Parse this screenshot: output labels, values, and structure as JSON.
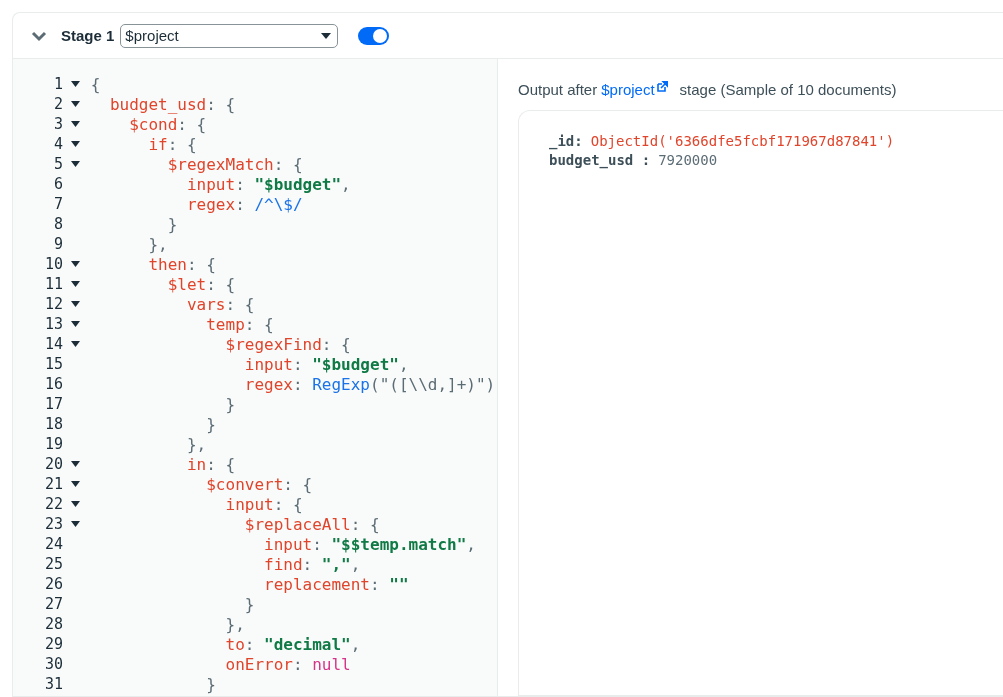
{
  "stage": {
    "expanded": true,
    "label": "Stage 1",
    "operator": "$project",
    "enabled": true
  },
  "editor": {
    "lines": [
      {
        "number": "1",
        "foldable": true,
        "tokens": [
          {
            "kind": "punct",
            "text": "{"
          }
        ]
      },
      {
        "number": "2",
        "foldable": true,
        "tokens": [
          {
            "kind": "key",
            "text": "  budget_usd"
          },
          {
            "kind": "punct",
            "text": ": {"
          }
        ]
      },
      {
        "number": "3",
        "foldable": true,
        "tokens": [
          {
            "kind": "key",
            "text": "    $cond"
          },
          {
            "kind": "punct",
            "text": ": {"
          }
        ]
      },
      {
        "number": "4",
        "foldable": true,
        "tokens": [
          {
            "kind": "key",
            "text": "      if"
          },
          {
            "kind": "punct",
            "text": ": {"
          }
        ]
      },
      {
        "number": "5",
        "foldable": true,
        "tokens": [
          {
            "kind": "key",
            "text": "        $regexMatch"
          },
          {
            "kind": "punct",
            "text": ": {"
          }
        ]
      },
      {
        "number": "6",
        "foldable": false,
        "tokens": [
          {
            "kind": "key",
            "text": "          input"
          },
          {
            "kind": "punct",
            "text": ": "
          },
          {
            "kind": "string",
            "text": "\"$budget\""
          },
          {
            "kind": "punct",
            "text": ","
          }
        ]
      },
      {
        "number": "7",
        "foldable": false,
        "tokens": [
          {
            "kind": "key",
            "text": "          regex"
          },
          {
            "kind": "punct",
            "text": ": "
          },
          {
            "kind": "regex",
            "text": "/^\\$/"
          }
        ]
      },
      {
        "number": "8",
        "foldable": false,
        "tokens": [
          {
            "kind": "punct",
            "text": "        }"
          }
        ]
      },
      {
        "number": "9",
        "foldable": false,
        "tokens": [
          {
            "kind": "punct",
            "text": "      },"
          }
        ]
      },
      {
        "number": "10",
        "foldable": true,
        "tokens": [
          {
            "kind": "key",
            "text": "      then"
          },
          {
            "kind": "punct",
            "text": ": {"
          }
        ]
      },
      {
        "number": "11",
        "foldable": true,
        "tokens": [
          {
            "kind": "key",
            "text": "        $let"
          },
          {
            "kind": "punct",
            "text": ": {"
          }
        ]
      },
      {
        "number": "12",
        "foldable": true,
        "tokens": [
          {
            "kind": "key",
            "text": "          vars"
          },
          {
            "kind": "punct",
            "text": ": {"
          }
        ]
      },
      {
        "number": "13",
        "foldable": true,
        "tokens": [
          {
            "kind": "key",
            "text": "            temp"
          },
          {
            "kind": "punct",
            "text": ": {"
          }
        ]
      },
      {
        "number": "14",
        "foldable": true,
        "tokens": [
          {
            "kind": "key",
            "text": "              $regexFind"
          },
          {
            "kind": "punct",
            "text": ": {"
          }
        ]
      },
      {
        "number": "15",
        "foldable": false,
        "tokens": [
          {
            "kind": "key",
            "text": "                input"
          },
          {
            "kind": "punct",
            "text": ": "
          },
          {
            "kind": "string",
            "text": "\"$budget\""
          },
          {
            "kind": "punct",
            "text": ","
          }
        ]
      },
      {
        "number": "16",
        "foldable": false,
        "tokens": [
          {
            "kind": "key",
            "text": "                regex"
          },
          {
            "kind": "punct",
            "text": ": "
          },
          {
            "kind": "regex",
            "text": "RegExp"
          },
          {
            "kind": "punct",
            "text": "(\"([\\\\d,]+)\")"
          }
        ]
      },
      {
        "number": "17",
        "foldable": false,
        "tokens": [
          {
            "kind": "punct",
            "text": "              }"
          }
        ]
      },
      {
        "number": "18",
        "foldable": false,
        "tokens": [
          {
            "kind": "punct",
            "text": "            }"
          }
        ]
      },
      {
        "number": "19",
        "foldable": false,
        "tokens": [
          {
            "kind": "punct",
            "text": "          },"
          }
        ]
      },
      {
        "number": "20",
        "foldable": true,
        "tokens": [
          {
            "kind": "key",
            "text": "          in"
          },
          {
            "kind": "punct",
            "text": ": {"
          }
        ]
      },
      {
        "number": "21",
        "foldable": true,
        "tokens": [
          {
            "kind": "key",
            "text": "            $convert"
          },
          {
            "kind": "punct",
            "text": ": {"
          }
        ]
      },
      {
        "number": "22",
        "foldable": true,
        "tokens": [
          {
            "kind": "key",
            "text": "              input"
          },
          {
            "kind": "punct",
            "text": ": {"
          }
        ]
      },
      {
        "number": "23",
        "foldable": true,
        "tokens": [
          {
            "kind": "key",
            "text": "                $replaceAll"
          },
          {
            "kind": "punct",
            "text": ": {"
          }
        ]
      },
      {
        "number": "24",
        "foldable": false,
        "tokens": [
          {
            "kind": "key",
            "text": "                  input"
          },
          {
            "kind": "punct",
            "text": ": "
          },
          {
            "kind": "string",
            "text": "\"$$temp.match\""
          },
          {
            "kind": "punct",
            "text": ","
          }
        ]
      },
      {
        "number": "25",
        "foldable": false,
        "tokens": [
          {
            "kind": "key",
            "text": "                  find"
          },
          {
            "kind": "punct",
            "text": ": "
          },
          {
            "kind": "string",
            "text": "\",\""
          },
          {
            "kind": "punct",
            "text": ","
          }
        ]
      },
      {
        "number": "26",
        "foldable": false,
        "tokens": [
          {
            "kind": "key",
            "text": "                  replacement"
          },
          {
            "kind": "punct",
            "text": ": "
          },
          {
            "kind": "string",
            "text": "\"\""
          }
        ]
      },
      {
        "number": "27",
        "foldable": false,
        "tokens": [
          {
            "kind": "punct",
            "text": "                }"
          }
        ]
      },
      {
        "number": "28",
        "foldable": false,
        "tokens": [
          {
            "kind": "punct",
            "text": "              },"
          }
        ]
      },
      {
        "number": "29",
        "foldable": false,
        "tokens": [
          {
            "kind": "key",
            "text": "              to"
          },
          {
            "kind": "punct",
            "text": ": "
          },
          {
            "kind": "string",
            "text": "\"decimal\""
          },
          {
            "kind": "punct",
            "text": ","
          }
        ]
      },
      {
        "number": "30",
        "foldable": false,
        "tokens": [
          {
            "kind": "key",
            "text": "              onError"
          },
          {
            "kind": "punct",
            "text": ": "
          },
          {
            "kind": "null",
            "text": "null"
          }
        ]
      },
      {
        "number": "31",
        "foldable": false,
        "tokens": [
          {
            "kind": "punct",
            "text": "            }"
          }
        ]
      }
    ]
  },
  "output": {
    "heading": {
      "before": "Output after",
      "link": "$project",
      "after": "stage (Sample of 10 documents)"
    },
    "fields": [
      {
        "key": "_id:",
        "value": "ObjectId('6366dfe5fcbf171967d87841')",
        "kind": "objectid"
      },
      {
        "key": "budget_usd :",
        "value": "7920000",
        "kind": "number"
      }
    ]
  }
}
